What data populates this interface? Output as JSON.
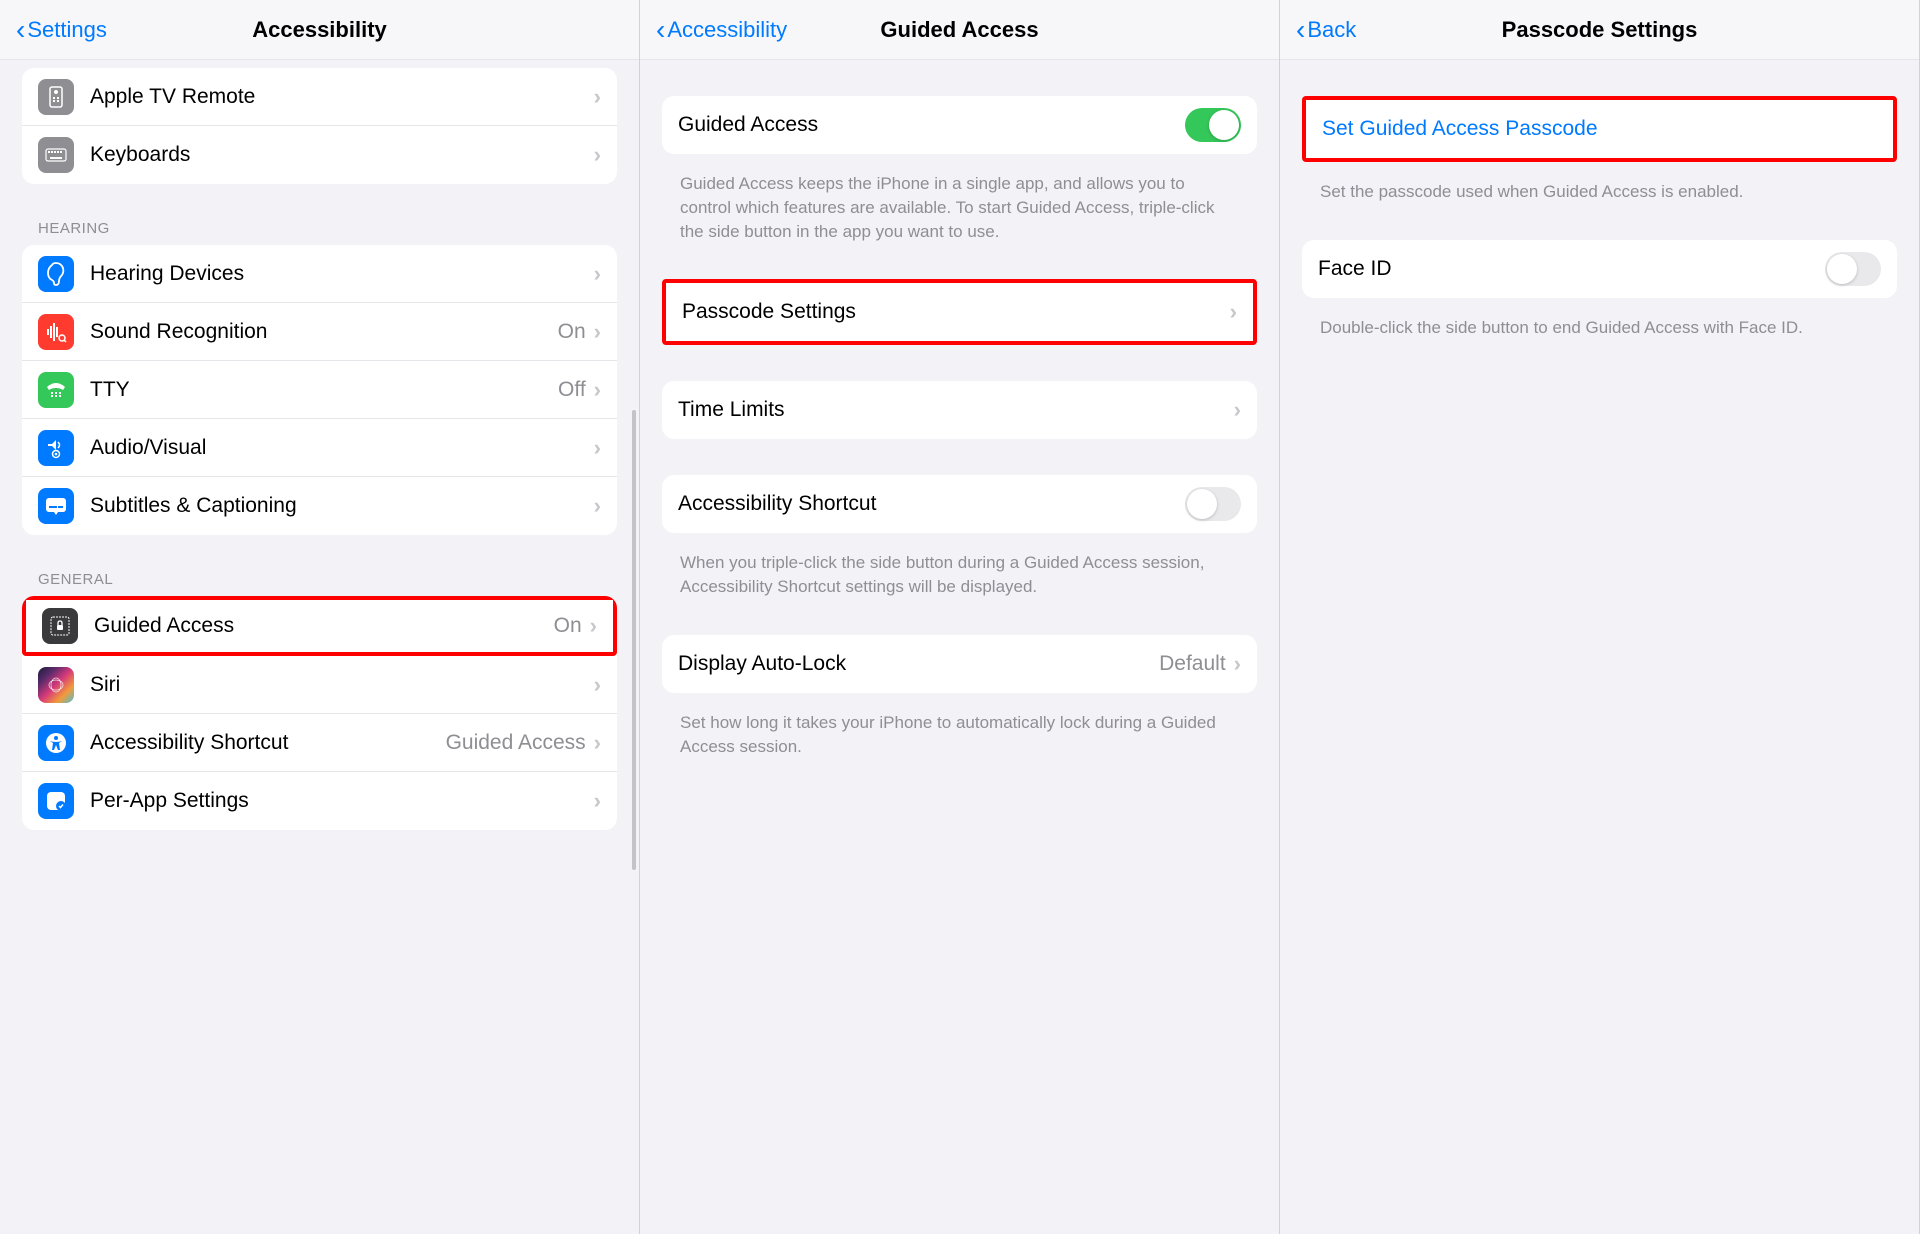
{
  "panel1": {
    "back": "Settings",
    "title": "Accessibility",
    "top_group": [
      {
        "label": "Apple TV Remote"
      },
      {
        "label": "Keyboards"
      }
    ],
    "hearing_header": "HEARING",
    "hearing_group": [
      {
        "label": "Hearing Devices",
        "value": ""
      },
      {
        "label": "Sound Recognition",
        "value": "On"
      },
      {
        "label": "TTY",
        "value": "Off"
      },
      {
        "label": "Audio/Visual",
        "value": ""
      },
      {
        "label": "Subtitles & Captioning",
        "value": ""
      }
    ],
    "general_header": "GENERAL",
    "general_group": [
      {
        "label": "Guided Access",
        "value": "On"
      },
      {
        "label": "Siri",
        "value": ""
      },
      {
        "label": "Accessibility Shortcut",
        "value": "Guided Access"
      },
      {
        "label": "Per-App Settings",
        "value": ""
      }
    ]
  },
  "panel2": {
    "back": "Accessibility",
    "title": "Guided Access",
    "guided_access": {
      "label": "Guided Access",
      "on": true
    },
    "guided_desc": "Guided Access keeps the iPhone in a single app, and allows you to control which features are available. To start Guided Access, triple-click the side button in the app you want to use.",
    "passcode": {
      "label": "Passcode Settings"
    },
    "time_limits": {
      "label": "Time Limits"
    },
    "shortcut": {
      "label": "Accessibility Shortcut",
      "on": false
    },
    "shortcut_desc": "When you triple-click the side button during a Guided Access session, Accessibility Shortcut settings will be displayed.",
    "autolock": {
      "label": "Display Auto-Lock",
      "value": "Default"
    },
    "autolock_desc": "Set how long it takes your iPhone to automatically lock during a Guided Access session."
  },
  "panel3": {
    "back": "Back",
    "title": "Passcode Settings",
    "set_passcode": {
      "label": "Set Guided Access Passcode"
    },
    "set_desc": "Set the passcode used when Guided Access is enabled.",
    "faceid": {
      "label": "Face ID",
      "on": false
    },
    "faceid_desc": "Double-click the side button to end Guided Access with Face ID."
  }
}
